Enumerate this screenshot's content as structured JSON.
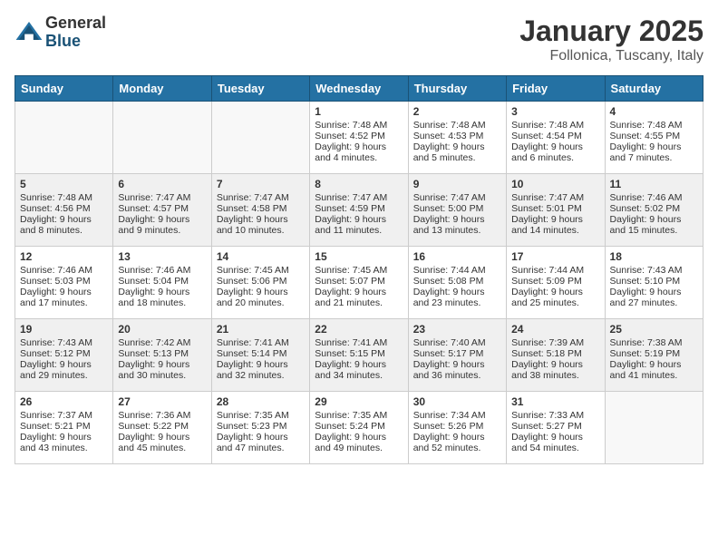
{
  "logo": {
    "general": "General",
    "blue": "Blue"
  },
  "title": "January 2025",
  "location": "Follonica, Tuscany, Italy",
  "weekdays": [
    "Sunday",
    "Monday",
    "Tuesday",
    "Wednesday",
    "Thursday",
    "Friday",
    "Saturday"
  ],
  "weeks": [
    [
      {
        "day": "",
        "text": ""
      },
      {
        "day": "",
        "text": ""
      },
      {
        "day": "",
        "text": ""
      },
      {
        "day": "1",
        "sunrise": "7:48 AM",
        "sunset": "4:52 PM",
        "daylight": "9 hours and 4 minutes."
      },
      {
        "day": "2",
        "sunrise": "7:48 AM",
        "sunset": "4:53 PM",
        "daylight": "9 hours and 5 minutes."
      },
      {
        "day": "3",
        "sunrise": "7:48 AM",
        "sunset": "4:54 PM",
        "daylight": "9 hours and 6 minutes."
      },
      {
        "day": "4",
        "sunrise": "7:48 AM",
        "sunset": "4:55 PM",
        "daylight": "9 hours and 7 minutes."
      }
    ],
    [
      {
        "day": "5",
        "sunrise": "7:48 AM",
        "sunset": "4:56 PM",
        "daylight": "9 hours and 8 minutes."
      },
      {
        "day": "6",
        "sunrise": "7:47 AM",
        "sunset": "4:57 PM",
        "daylight": "9 hours and 9 minutes."
      },
      {
        "day": "7",
        "sunrise": "7:47 AM",
        "sunset": "4:58 PM",
        "daylight": "9 hours and 10 minutes."
      },
      {
        "day": "8",
        "sunrise": "7:47 AM",
        "sunset": "4:59 PM",
        "daylight": "9 hours and 11 minutes."
      },
      {
        "day": "9",
        "sunrise": "7:47 AM",
        "sunset": "5:00 PM",
        "daylight": "9 hours and 13 minutes."
      },
      {
        "day": "10",
        "sunrise": "7:47 AM",
        "sunset": "5:01 PM",
        "daylight": "9 hours and 14 minutes."
      },
      {
        "day": "11",
        "sunrise": "7:46 AM",
        "sunset": "5:02 PM",
        "daylight": "9 hours and 15 minutes."
      }
    ],
    [
      {
        "day": "12",
        "sunrise": "7:46 AM",
        "sunset": "5:03 PM",
        "daylight": "9 hours and 17 minutes."
      },
      {
        "day": "13",
        "sunrise": "7:46 AM",
        "sunset": "5:04 PM",
        "daylight": "9 hours and 18 minutes."
      },
      {
        "day": "14",
        "sunrise": "7:45 AM",
        "sunset": "5:06 PM",
        "daylight": "9 hours and 20 minutes."
      },
      {
        "day": "15",
        "sunrise": "7:45 AM",
        "sunset": "5:07 PM",
        "daylight": "9 hours and 21 minutes."
      },
      {
        "day": "16",
        "sunrise": "7:44 AM",
        "sunset": "5:08 PM",
        "daylight": "9 hours and 23 minutes."
      },
      {
        "day": "17",
        "sunrise": "7:44 AM",
        "sunset": "5:09 PM",
        "daylight": "9 hours and 25 minutes."
      },
      {
        "day": "18",
        "sunrise": "7:43 AM",
        "sunset": "5:10 PM",
        "daylight": "9 hours and 27 minutes."
      }
    ],
    [
      {
        "day": "19",
        "sunrise": "7:43 AM",
        "sunset": "5:12 PM",
        "daylight": "9 hours and 29 minutes."
      },
      {
        "day": "20",
        "sunrise": "7:42 AM",
        "sunset": "5:13 PM",
        "daylight": "9 hours and 30 minutes."
      },
      {
        "day": "21",
        "sunrise": "7:41 AM",
        "sunset": "5:14 PM",
        "daylight": "9 hours and 32 minutes."
      },
      {
        "day": "22",
        "sunrise": "7:41 AM",
        "sunset": "5:15 PM",
        "daylight": "9 hours and 34 minutes."
      },
      {
        "day": "23",
        "sunrise": "7:40 AM",
        "sunset": "5:17 PM",
        "daylight": "9 hours and 36 minutes."
      },
      {
        "day": "24",
        "sunrise": "7:39 AM",
        "sunset": "5:18 PM",
        "daylight": "9 hours and 38 minutes."
      },
      {
        "day": "25",
        "sunrise": "7:38 AM",
        "sunset": "5:19 PM",
        "daylight": "9 hours and 41 minutes."
      }
    ],
    [
      {
        "day": "26",
        "sunrise": "7:37 AM",
        "sunset": "5:21 PM",
        "daylight": "9 hours and 43 minutes."
      },
      {
        "day": "27",
        "sunrise": "7:36 AM",
        "sunset": "5:22 PM",
        "daylight": "9 hours and 45 minutes."
      },
      {
        "day": "28",
        "sunrise": "7:35 AM",
        "sunset": "5:23 PM",
        "daylight": "9 hours and 47 minutes."
      },
      {
        "day": "29",
        "sunrise": "7:35 AM",
        "sunset": "5:24 PM",
        "daylight": "9 hours and 49 minutes."
      },
      {
        "day": "30",
        "sunrise": "7:34 AM",
        "sunset": "5:26 PM",
        "daylight": "9 hours and 52 minutes."
      },
      {
        "day": "31",
        "sunrise": "7:33 AM",
        "sunset": "5:27 PM",
        "daylight": "9 hours and 54 minutes."
      },
      {
        "day": "",
        "text": ""
      }
    ]
  ]
}
